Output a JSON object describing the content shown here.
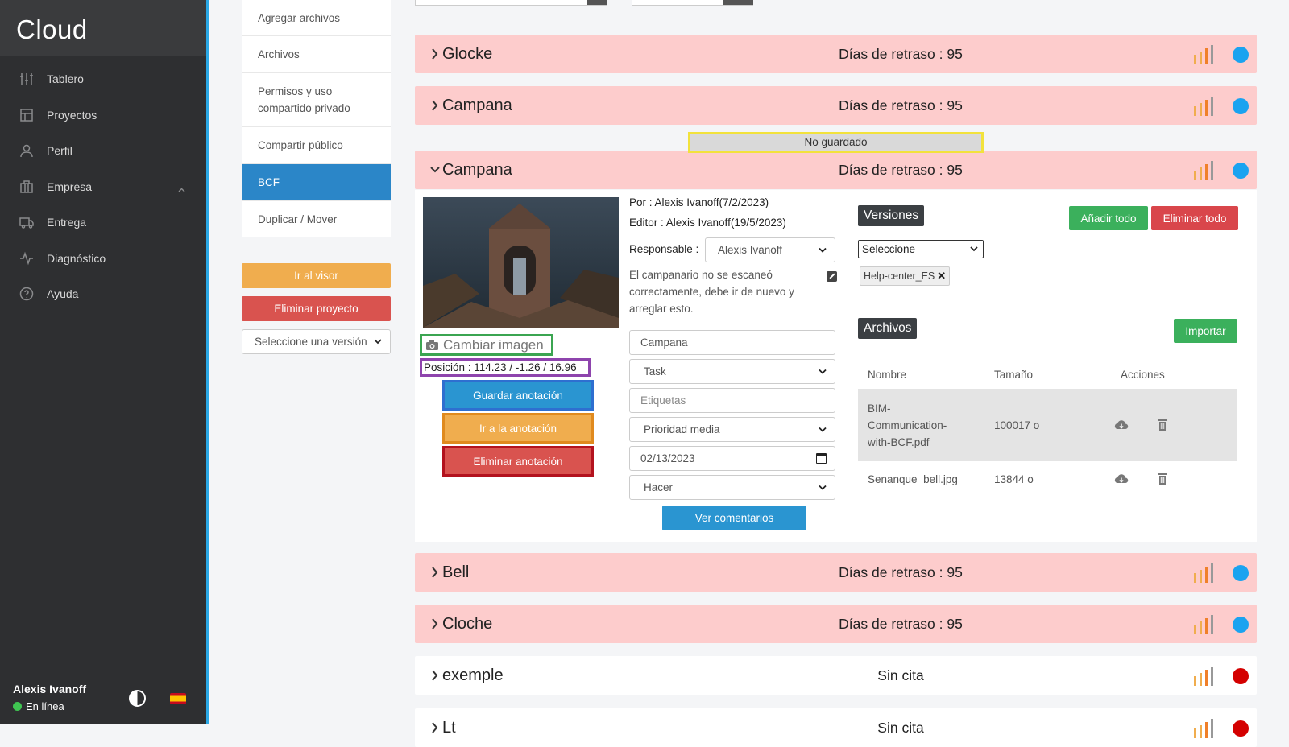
{
  "brand": "Cloud",
  "nav": [
    {
      "label": "Tablero",
      "icon": "sliders-icon"
    },
    {
      "label": "Proyectos",
      "icon": "layout-icon"
    },
    {
      "label": "Perfil",
      "icon": "user-icon"
    },
    {
      "label": "Empresa",
      "icon": "briefcase-icon"
    },
    {
      "label": "Entrega",
      "icon": "truck-icon"
    },
    {
      "label": "Diagnóstico",
      "icon": "activity-icon"
    },
    {
      "label": "Ayuda",
      "icon": "help-icon"
    }
  ],
  "user": {
    "name": "Alexis Ivanoff",
    "status": "En línea"
  },
  "submenu": [
    {
      "label": "Agregar archivos"
    },
    {
      "label": "Archivos"
    },
    {
      "label": "Permisos y uso compartido privado"
    },
    {
      "label": "Compartir público"
    },
    {
      "label": "BCF"
    },
    {
      "label": "Duplicar / Mover"
    }
  ],
  "side_buttons": {
    "viewer": "Ir al visor",
    "delete_project": "Eliminar proyecto",
    "version_select": "Seleccione una versión"
  },
  "issues": [
    {
      "name": "Glocke",
      "status": "Días de retraso : 95",
      "status_color": "#1aa3f0"
    },
    {
      "name": "Campana",
      "status": "Días de retraso : 95",
      "status_color": "#1aa3f0"
    },
    {
      "name": "Campana",
      "status": "Días de retraso : 95",
      "status_color": "#1aa3f0",
      "expanded": true
    },
    {
      "name": "Bell",
      "status": "Días de retraso : 95",
      "status_color": "#1aa3f0"
    },
    {
      "name": "Cloche",
      "status": "Días de retraso : 95",
      "status_color": "#1aa3f0"
    },
    {
      "name": "exemple",
      "status": "Sin cita",
      "status_color": "#d40000"
    },
    {
      "name": "Lt",
      "status": "Sin cita",
      "status_color": "#d40000"
    }
  ],
  "not_saved": "No guardado",
  "detail": {
    "change_image": "Cambiar imagen",
    "position": "Posición : 114.23 / -1.26 / 16.96",
    "save_annotation": "Guardar anotación",
    "go_annotation": "Ir a la anotación",
    "delete_annotation": "Eliminar anotación",
    "by": "Por : Alexis Ivanoff(7/2/2023)",
    "editor": "Editor : Alexis Ivanoff(19/5/2023)",
    "responsible_label": "Responsable :",
    "responsible": "Alexis Ivanoff",
    "description": "El campanario no se escaneó correctamente, debe ir de nuevo y arreglar esto.",
    "title_value": "Campana",
    "type": "Task",
    "tags_placeholder": "Etiquetas",
    "priority": "Prioridad media",
    "date": "02/13/2023",
    "state": "Hacer",
    "view_comments": "Ver comentarios",
    "versions_title": "Versiones",
    "add_all": "Añadir todo",
    "delete_all": "Eliminar todo",
    "versions_select": "Seleccione",
    "version_tag": "Help-center_ES",
    "files_title": "Archivos",
    "import": "Importar",
    "columns": [
      "Nombre",
      "Tamaño",
      "Acciones"
    ],
    "files": [
      {
        "name": "BIM-Communication-with-BCF.pdf",
        "size": "100017 o"
      },
      {
        "name": "Senanque_bell.jpg",
        "size": "13844 o"
      }
    ]
  },
  "colors": {
    "accent": "#2aa8e6",
    "row_bg": "#fdcccc",
    "orange": "#f0ad4e",
    "red": "#d9534f"
  }
}
